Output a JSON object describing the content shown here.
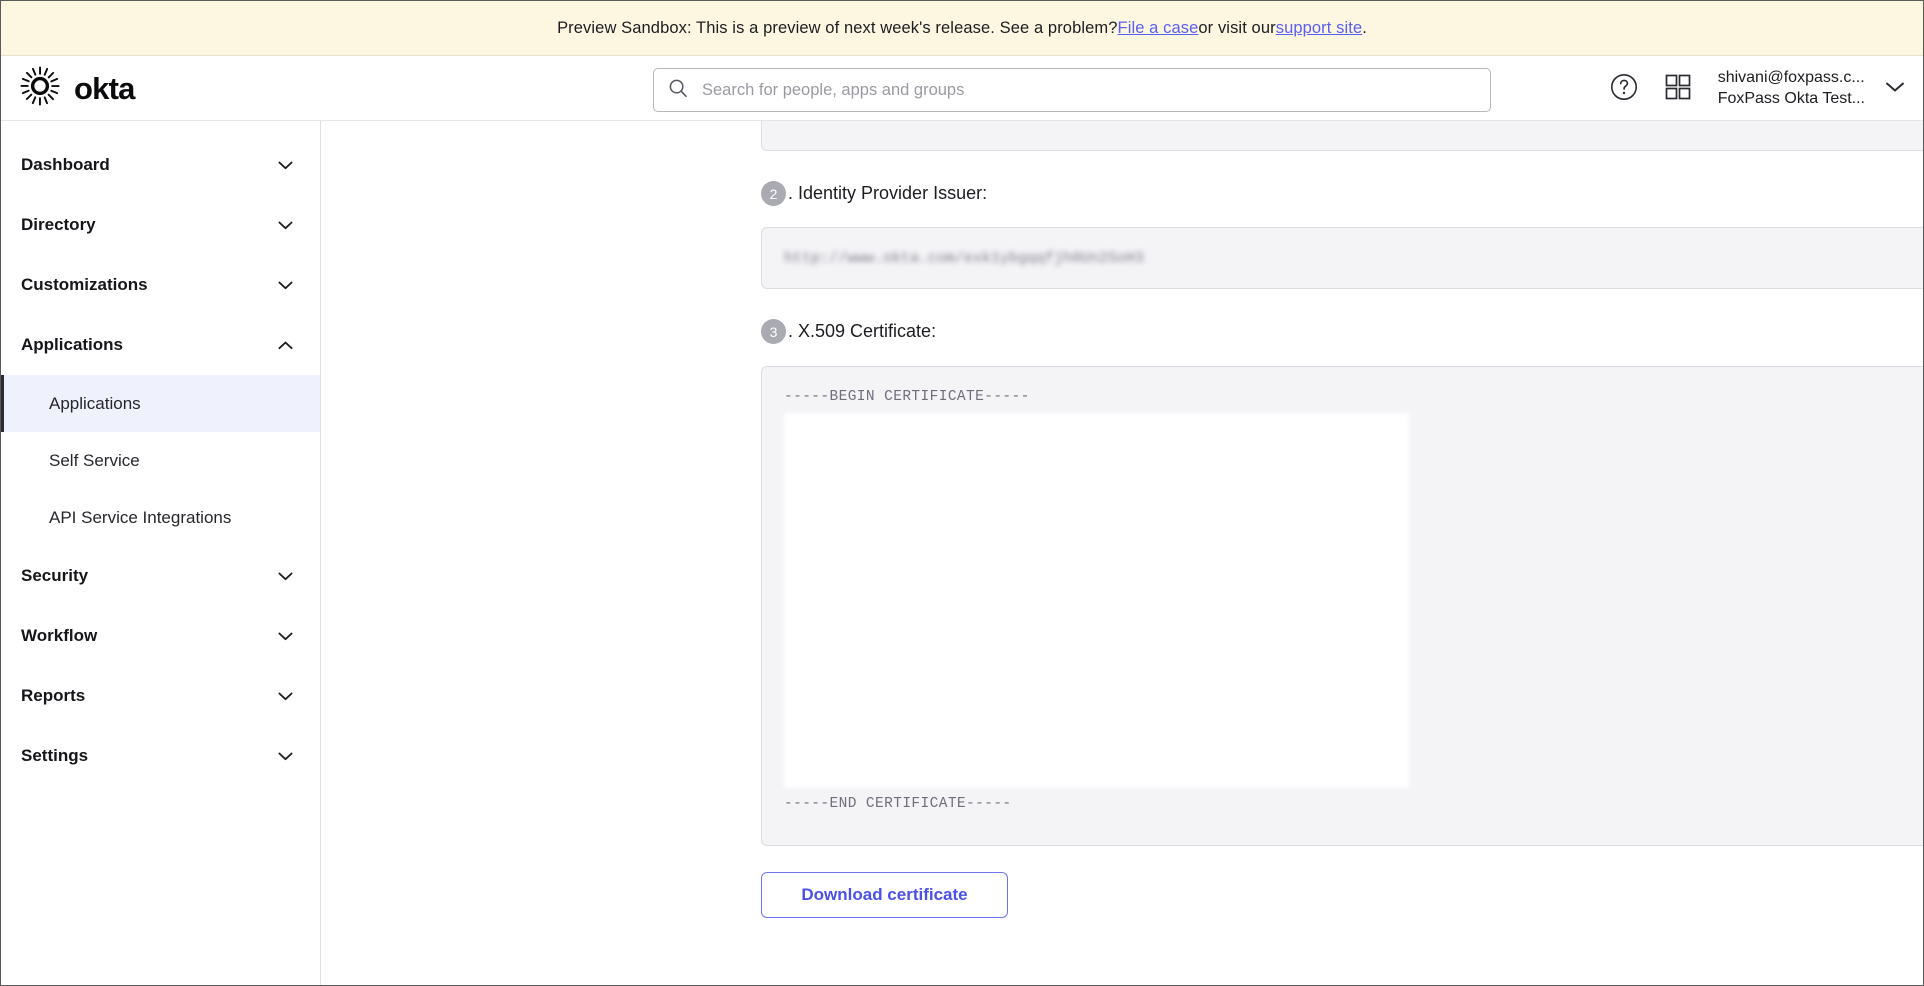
{
  "banner": {
    "text_before_link1": "Preview Sandbox: This is a preview of next week's release. See a problem? ",
    "link1": "File a case",
    "text_between": " or visit our ",
    "link2": "support site",
    "text_after": ".",
    "background_color": "#FDF7E2",
    "link_color": "#5b60f1"
  },
  "header": {
    "brand_name": "okta",
    "logo_icon": "okta-radial-burst-logo",
    "help_icon": "question-circle-icon",
    "apps_icon": "apps-grid-icon",
    "chevron_icon": "chevron-down-icon",
    "user": {
      "email": "shivani@foxpass.c...",
      "org": "FoxPass Okta Test..."
    }
  },
  "search": {
    "placeholder": "Search for people, apps and groups",
    "value": "",
    "icon": "search-icon"
  },
  "sidebar": {
    "items": [
      {
        "label": "Dashboard",
        "type": "group",
        "expanded": false,
        "icon": "chevron-down-icon"
      },
      {
        "label": "Directory",
        "type": "group",
        "expanded": false,
        "icon": "chevron-down-icon"
      },
      {
        "label": "Customizations",
        "type": "group",
        "expanded": false,
        "icon": "chevron-down-icon"
      },
      {
        "label": "Applications",
        "type": "group",
        "expanded": true,
        "icon": "chevron-up-icon"
      },
      {
        "label": "Applications",
        "type": "sub",
        "active": true
      },
      {
        "label": "Self Service",
        "type": "sub",
        "active": false
      },
      {
        "label": "API Service Integrations",
        "type": "sub",
        "active": false
      },
      {
        "label": "Security",
        "type": "group",
        "expanded": false,
        "icon": "chevron-down-icon"
      },
      {
        "label": "Workflow",
        "type": "group",
        "expanded": false,
        "icon": "chevron-down-icon"
      },
      {
        "label": "Reports",
        "type": "group",
        "expanded": false,
        "icon": "chevron-down-icon"
      },
      {
        "label": "Settings",
        "type": "group",
        "expanded": false,
        "icon": "chevron-down-icon"
      }
    ],
    "active_item_background": "#EFF2FD"
  },
  "main": {
    "step2": {
      "number": "2",
      "label": ". Identity Provider Issuer:",
      "value_redacted": "http://www.okta.com/exk1ybgqqfjh0Un2SoH3"
    },
    "step3": {
      "number": "3",
      "label": ". X.509 Certificate:",
      "cert_begin": "-----BEGIN CERTIFICATE-----",
      "cert_body_redacted": "",
      "cert_end": "-----END CERTIFICATE-----"
    },
    "download_button": "Download certificate",
    "download_button_color": "#4b51e8"
  }
}
